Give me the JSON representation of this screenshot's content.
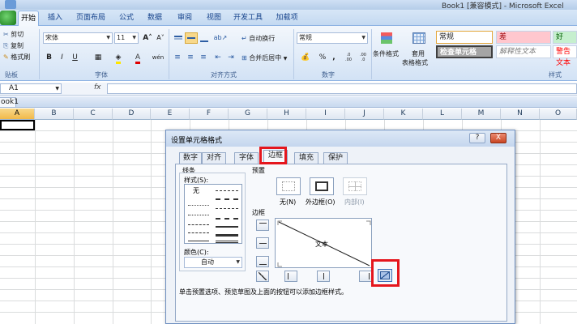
{
  "window": {
    "title": "Book1 [兼容模式] - Microsoft Excel"
  },
  "ribbon_tabs": [
    "开始",
    "插入",
    "页面布局",
    "公式",
    "数据",
    "审阅",
    "视图",
    "开发工具",
    "加载项"
  ],
  "clipboard": {
    "cut": "剪切",
    "copy": "复制",
    "format_painter": "格式刷",
    "group_label": "贴板"
  },
  "font": {
    "name": "宋体",
    "size": "11",
    "group_label": "字体",
    "bold": "B",
    "italic": "I",
    "underline": "U",
    "grow": "A˄",
    "shrink": "A˅",
    "font_color_letter": "A",
    "phonetic": "wén"
  },
  "alignment": {
    "wrap_text": "自动换行",
    "merge_center": "合并后居中",
    "group_label": "对齐方式"
  },
  "number": {
    "format": "常规",
    "percent": "%",
    "comma": ",",
    "group_label": "数字",
    "inc_decimal": ".0 .00",
    "dec_decimal": ".00 .0"
  },
  "styles": {
    "conditional": "条件格式",
    "table": "套用\n表格格式",
    "table_line1": "套用",
    "table_line2": "表格格式",
    "normal": "常规",
    "bad": "差",
    "good": "好",
    "check_cell": "检查单元格",
    "explanatory": "解释性文本",
    "warning": "警告文本",
    "group_label": "样式"
  },
  "formula_bar": {
    "name_box": "A1",
    "fx": "fx",
    "value": ""
  },
  "workbook": {
    "tab": "ook1"
  },
  "columns": [
    "A",
    "B",
    "C",
    "D",
    "E",
    "F",
    "G",
    "H",
    "I",
    "J",
    "K",
    "L",
    "M",
    "N",
    "O"
  ],
  "dialog": {
    "title": "设置单元格格式",
    "help": "?",
    "close": "X",
    "tabs": [
      "数字",
      "对齐",
      "字体",
      "边框",
      "填充",
      "保护"
    ],
    "active_tab": "边框",
    "line_section": "线条",
    "style_label": "样式(S):",
    "none_style": "无",
    "color_label": "颜色(C):",
    "color_value": "自动",
    "preset_section": "预置",
    "presets": [
      "无(N)",
      "外边框(O)",
      "内部(I)"
    ],
    "border_section": "边框",
    "preview_text": "文本",
    "hint": "单击预置选项、预览草图及上面的按钮可以添加边框样式。"
  }
}
